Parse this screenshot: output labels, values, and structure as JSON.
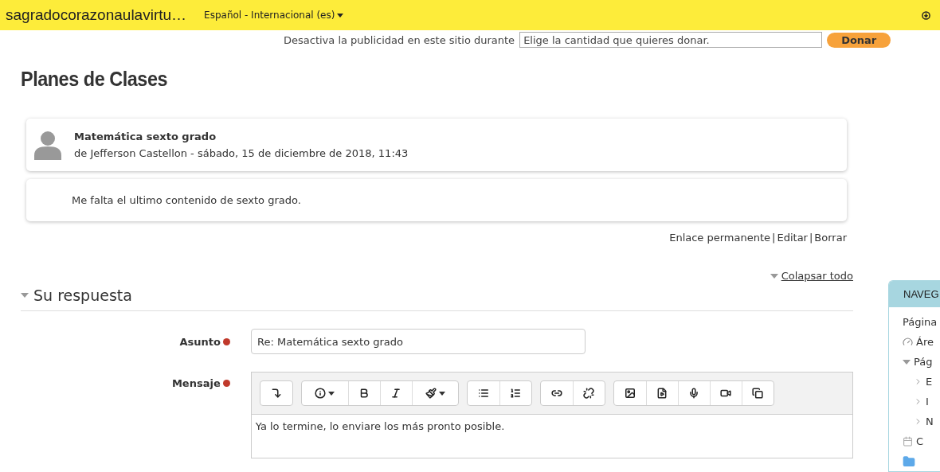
{
  "top_bar": {
    "site_name": "sagradocorazonaulavirtu…",
    "language": "Español - Internacional (es)"
  },
  "ad_bar": {
    "text": "Desactiva la publicidad en este sitio durante",
    "select_value": "Elige la cantidad que quieres donar.",
    "button": "Donar"
  },
  "page_title": "Planes de Clases",
  "post": {
    "subject": "Matemática sexto grado",
    "byline": "de Jefferson Castellon - sábado, 15 de diciembre de 2018, 11:43",
    "message": "Me falta el ultimo contenido de sexto grado.",
    "links": [
      "Enlace permanente",
      "Editar",
      "Borrar"
    ],
    "link_separator": "|"
  },
  "collapse_all": "Colapsar todo",
  "reply": {
    "heading": "Su respuesta",
    "expanded": true,
    "fields": [
      {
        "label": "Asunto",
        "required": true,
        "value": "Re: Matemática sexto grado"
      },
      {
        "label": "Mensaje",
        "required": true
      }
    ],
    "toolbar": [
      [
        {
          "kind": "collapse",
          "dropdown": false
        }
      ],
      [
        {
          "kind": "info",
          "dropdown": true
        },
        {
          "kind": "bold",
          "dropdown": false
        },
        {
          "kind": "italic",
          "dropdown": false
        },
        {
          "kind": "brush",
          "dropdown": true
        }
      ],
      [
        {
          "kind": "bullets",
          "dropdown": false
        },
        {
          "kind": "numbers",
          "dropdown": false
        }
      ],
      [
        {
          "kind": "link",
          "dropdown": false
        },
        {
          "kind": "unlink",
          "dropdown": false
        }
      ],
      [
        {
          "kind": "image",
          "dropdown": false
        },
        {
          "kind": "media",
          "dropdown": false
        },
        {
          "kind": "mic",
          "dropdown": false
        },
        {
          "kind": "video",
          "dropdown": false
        },
        {
          "kind": "copy",
          "dropdown": false
        }
      ]
    ],
    "message_text": "Ya lo termine, lo enviare los más pronto posible."
  },
  "navigation": {
    "title": "NAVEG",
    "items": [
      {
        "label": "Página",
        "kind": "plain"
      },
      {
        "label": "Áre",
        "kind": "dashboard"
      },
      {
        "label": "Pág",
        "kind": "expanded",
        "children": [
          {
            "label": "E",
            "kind": "collapsed"
          },
          {
            "label": "I",
            "kind": "collapsed"
          },
          {
            "label": "N",
            "kind": "collapsed"
          }
        ]
      },
      {
        "label": "C",
        "kind": "calendar"
      },
      {
        "kind": "folder"
      }
    ]
  }
}
